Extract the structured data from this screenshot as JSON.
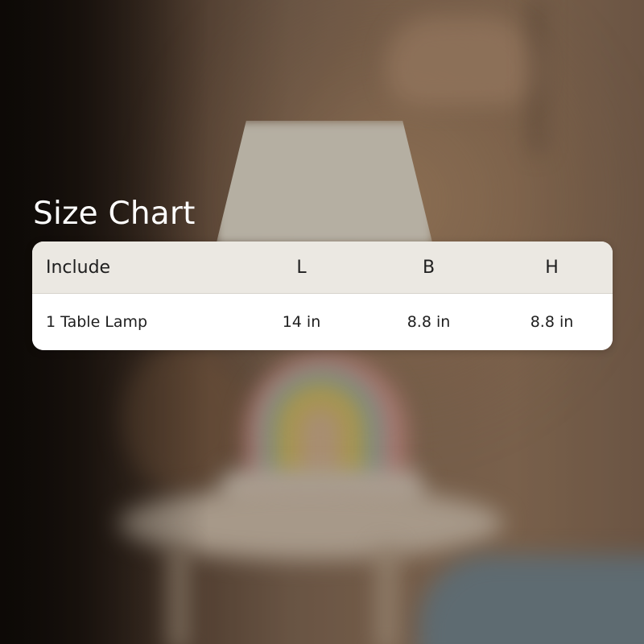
{
  "title": "Size Chart",
  "table": {
    "headers": [
      "Include",
      "L",
      "B",
      "H"
    ],
    "rows": [
      [
        "1 Table Lamp",
        "14 in",
        "8.8 in",
        "8.8 in"
      ]
    ]
  },
  "colors": {
    "title_text": "#ffffff",
    "header_background": "#ebe8e2",
    "row_background": "#ffffff",
    "cell_text": "#1e1e1e"
  }
}
